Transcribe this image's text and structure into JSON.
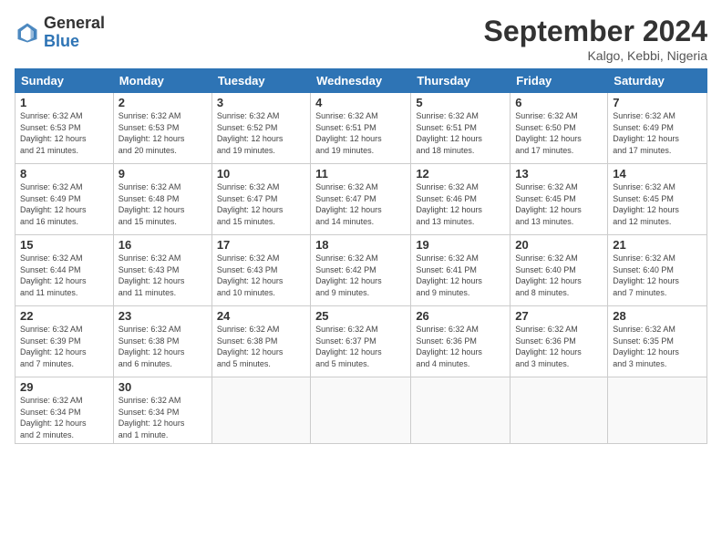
{
  "header": {
    "logo_line1": "General",
    "logo_line2": "Blue",
    "month_title": "September 2024",
    "subtitle": "Kalgo, Kebbi, Nigeria"
  },
  "days_of_week": [
    "Sunday",
    "Monday",
    "Tuesday",
    "Wednesday",
    "Thursday",
    "Friday",
    "Saturday"
  ],
  "weeks": [
    [
      {
        "day": "1",
        "info": "Sunrise: 6:32 AM\nSunset: 6:53 PM\nDaylight: 12 hours\nand 21 minutes."
      },
      {
        "day": "2",
        "info": "Sunrise: 6:32 AM\nSunset: 6:53 PM\nDaylight: 12 hours\nand 20 minutes."
      },
      {
        "day": "3",
        "info": "Sunrise: 6:32 AM\nSunset: 6:52 PM\nDaylight: 12 hours\nand 19 minutes."
      },
      {
        "day": "4",
        "info": "Sunrise: 6:32 AM\nSunset: 6:51 PM\nDaylight: 12 hours\nand 19 minutes."
      },
      {
        "day": "5",
        "info": "Sunrise: 6:32 AM\nSunset: 6:51 PM\nDaylight: 12 hours\nand 18 minutes."
      },
      {
        "day": "6",
        "info": "Sunrise: 6:32 AM\nSunset: 6:50 PM\nDaylight: 12 hours\nand 17 minutes."
      },
      {
        "day": "7",
        "info": "Sunrise: 6:32 AM\nSunset: 6:49 PM\nDaylight: 12 hours\nand 17 minutes."
      }
    ],
    [
      {
        "day": "8",
        "info": "Sunrise: 6:32 AM\nSunset: 6:49 PM\nDaylight: 12 hours\nand 16 minutes."
      },
      {
        "day": "9",
        "info": "Sunrise: 6:32 AM\nSunset: 6:48 PM\nDaylight: 12 hours\nand 15 minutes."
      },
      {
        "day": "10",
        "info": "Sunrise: 6:32 AM\nSunset: 6:47 PM\nDaylight: 12 hours\nand 15 minutes."
      },
      {
        "day": "11",
        "info": "Sunrise: 6:32 AM\nSunset: 6:47 PM\nDaylight: 12 hours\nand 14 minutes."
      },
      {
        "day": "12",
        "info": "Sunrise: 6:32 AM\nSunset: 6:46 PM\nDaylight: 12 hours\nand 13 minutes."
      },
      {
        "day": "13",
        "info": "Sunrise: 6:32 AM\nSunset: 6:45 PM\nDaylight: 12 hours\nand 13 minutes."
      },
      {
        "day": "14",
        "info": "Sunrise: 6:32 AM\nSunset: 6:45 PM\nDaylight: 12 hours\nand 12 minutes."
      }
    ],
    [
      {
        "day": "15",
        "info": "Sunrise: 6:32 AM\nSunset: 6:44 PM\nDaylight: 12 hours\nand 11 minutes."
      },
      {
        "day": "16",
        "info": "Sunrise: 6:32 AM\nSunset: 6:43 PM\nDaylight: 12 hours\nand 11 minutes."
      },
      {
        "day": "17",
        "info": "Sunrise: 6:32 AM\nSunset: 6:43 PM\nDaylight: 12 hours\nand 10 minutes."
      },
      {
        "day": "18",
        "info": "Sunrise: 6:32 AM\nSunset: 6:42 PM\nDaylight: 12 hours\nand 9 minutes."
      },
      {
        "day": "19",
        "info": "Sunrise: 6:32 AM\nSunset: 6:41 PM\nDaylight: 12 hours\nand 9 minutes."
      },
      {
        "day": "20",
        "info": "Sunrise: 6:32 AM\nSunset: 6:40 PM\nDaylight: 12 hours\nand 8 minutes."
      },
      {
        "day": "21",
        "info": "Sunrise: 6:32 AM\nSunset: 6:40 PM\nDaylight: 12 hours\nand 7 minutes."
      }
    ],
    [
      {
        "day": "22",
        "info": "Sunrise: 6:32 AM\nSunset: 6:39 PM\nDaylight: 12 hours\nand 7 minutes."
      },
      {
        "day": "23",
        "info": "Sunrise: 6:32 AM\nSunset: 6:38 PM\nDaylight: 12 hours\nand 6 minutes."
      },
      {
        "day": "24",
        "info": "Sunrise: 6:32 AM\nSunset: 6:38 PM\nDaylight: 12 hours\nand 5 minutes."
      },
      {
        "day": "25",
        "info": "Sunrise: 6:32 AM\nSunset: 6:37 PM\nDaylight: 12 hours\nand 5 minutes."
      },
      {
        "day": "26",
        "info": "Sunrise: 6:32 AM\nSunset: 6:36 PM\nDaylight: 12 hours\nand 4 minutes."
      },
      {
        "day": "27",
        "info": "Sunrise: 6:32 AM\nSunset: 6:36 PM\nDaylight: 12 hours\nand 3 minutes."
      },
      {
        "day": "28",
        "info": "Sunrise: 6:32 AM\nSunset: 6:35 PM\nDaylight: 12 hours\nand 3 minutes."
      }
    ],
    [
      {
        "day": "29",
        "info": "Sunrise: 6:32 AM\nSunset: 6:34 PM\nDaylight: 12 hours\nand 2 minutes."
      },
      {
        "day": "30",
        "info": "Sunrise: 6:32 AM\nSunset: 6:34 PM\nDaylight: 12 hours\nand 1 minute."
      },
      null,
      null,
      null,
      null,
      null
    ]
  ]
}
